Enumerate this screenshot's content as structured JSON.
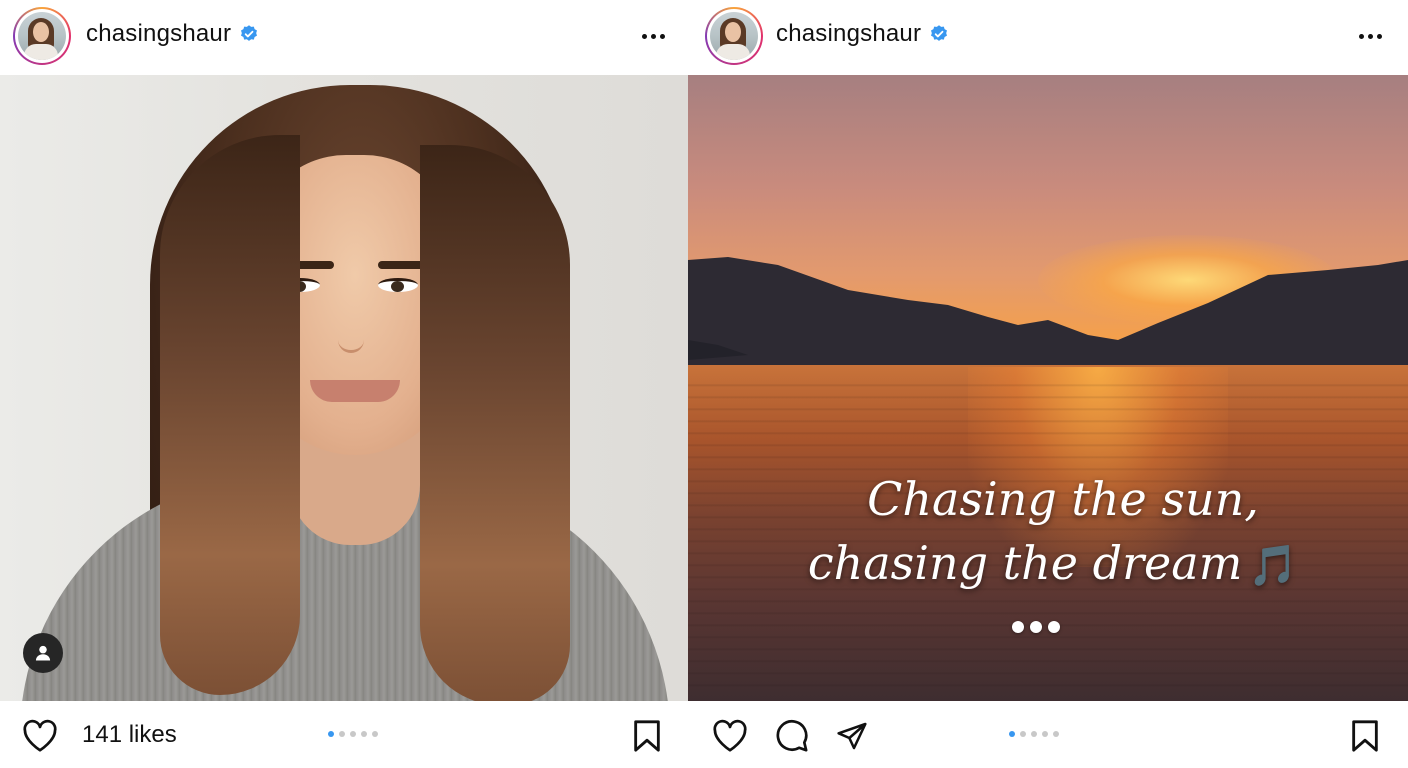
{
  "posts": [
    {
      "username": "chasingshaur",
      "verified": true,
      "photo_description_icon": "portrait",
      "likes_text": "141 likes",
      "carousel": {
        "count": 5,
        "active_index": 0
      }
    },
    {
      "username": "chasingshaur",
      "verified": true,
      "caption_line1": "Chasing the sun,",
      "caption_line2": "chasing the dream",
      "caption_emoji": "🎵",
      "carousel": {
        "count": 5,
        "active_index": 0
      }
    }
  ],
  "colors": {
    "accent_blue": "#3897f0",
    "verified_blue": "#3897f0",
    "text": "#111111"
  },
  "icons": [
    "heart-icon",
    "comment-icon",
    "share-icon",
    "bookmark-icon",
    "more-icon",
    "verified-icon",
    "user-tag-icon"
  ]
}
